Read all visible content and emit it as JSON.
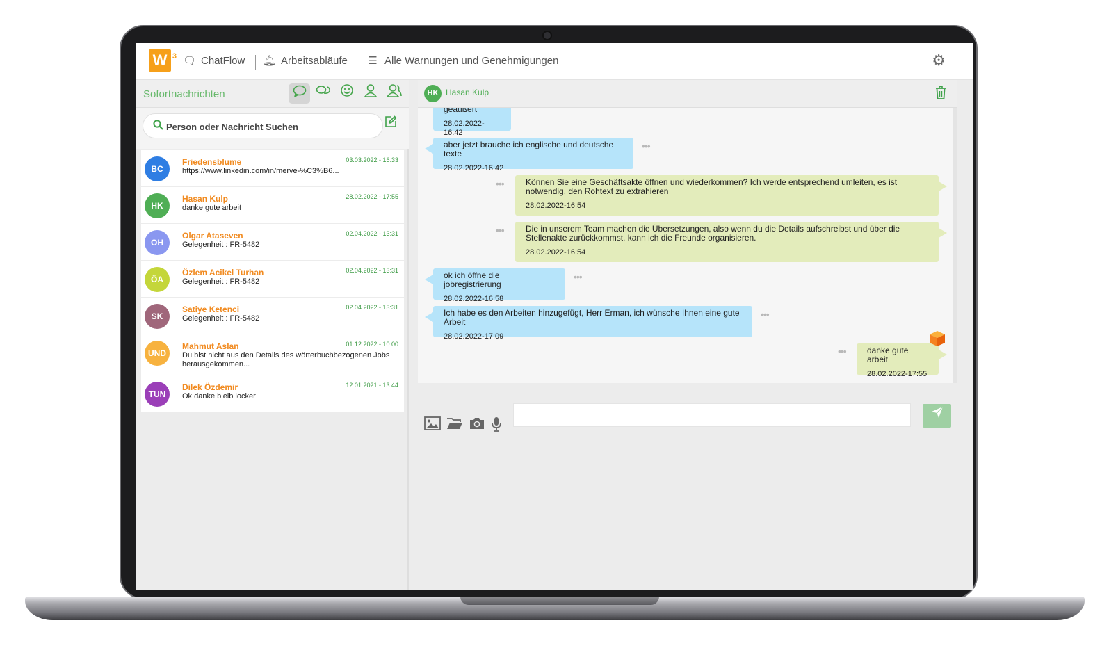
{
  "header": {
    "logo_text": "W",
    "logo_sup": "3",
    "nav": [
      {
        "label": "ChatFlow",
        "icon": "chat-bubbles-icon"
      },
      {
        "label": "Arbeitsabläufe",
        "icon": "bell-icon"
      },
      {
        "label": "Alle Warnungen und Genehmigungen",
        "icon": "list-icon"
      }
    ],
    "settings_icon": "gear-icon"
  },
  "sidebar": {
    "title": "Sofortnachrichten",
    "search_placeholder": "Person oder Nachricht Suchen",
    "contacts": [
      {
        "initials": "BC",
        "name": "Friedensblume",
        "message": "https://www.linkedin.com/in/merve-%C3%B6...",
        "time": "03.03.2022 - 16:33",
        "color": "#2f7ee3"
      },
      {
        "initials": "HK",
        "name": "Hasan Kulp",
        "message": "danke gute arbeit",
        "time": "28.02.2022 - 17:55",
        "color": "#4fae55"
      },
      {
        "initials": "OH",
        "name": "Olgar Ataseven",
        "message": "Gelegenheit : FR-5482",
        "time": "02.04.2022 - 13:31",
        "color": "#8a97f0"
      },
      {
        "initials": "ÖA",
        "name": "Özlem Acikel Turhan",
        "message": "Gelegenheit : FR-5482",
        "time": "02.04.2022 - 13:31",
        "color": "#c4d63a"
      },
      {
        "initials": "SK",
        "name": "Satiye Ketenci",
        "message": "Gelegenheit : FR-5482",
        "time": "02.04.2022 - 13:31",
        "color": "#a0677b"
      },
      {
        "initials": "UND",
        "name": "Mahmut Aslan",
        "message": "Du bist nicht aus den Details des wörterbuchbezogenen Jobs herausgekommen...",
        "time": "01.12.2022 - 10:00",
        "color": "#f7b23f"
      },
      {
        "initials": "TUN",
        "name": "Dilek Özdemir",
        "message": "Ok danke bleib locker",
        "time": "12.01.2021 - 13:44",
        "color": "#9b3fb8"
      }
    ]
  },
  "chat": {
    "contact_initials": "HK",
    "contact_name": "Hasan Kulp",
    "messages": [
      {
        "dir": "in",
        "text": "geäußert",
        "time": "28.02.2022-16:42"
      },
      {
        "dir": "in",
        "text": "aber jetzt brauche ich englische und deutsche texte",
        "time": "28.02.2022-16:42"
      },
      {
        "dir": "out",
        "text": "Können Sie eine Geschäftsakte öffnen und wiederkommen? Ich werde entsprechend umleiten, es ist notwendig, den Rohtext zu extrahieren",
        "time": "28.02.2022-16:54"
      },
      {
        "dir": "out",
        "text": "Die in unserem Team machen die Übersetzungen, also wenn du die Details aufschreibst und über die Stellenakte zurückkommst, kann ich die Freunde organisieren.",
        "time": "28.02.2022-16:54"
      },
      {
        "dir": "in",
        "text": "ok ich öffne die jobregistrierung",
        "time": "28.02.2022-16:58"
      },
      {
        "dir": "in",
        "text": "Ich habe es den Arbeiten hinzugefügt, Herr Erman, ich wünsche Ihnen eine gute Arbeit",
        "time": "28.02.2022-17:09"
      },
      {
        "dir": "out",
        "text": "danke gute arbeit",
        "time": "28.02.2022-17:55"
      }
    ],
    "options_glyph": "•••",
    "composer_icons": [
      "image-icon",
      "folder-icon",
      "camera-icon",
      "microphone-icon"
    ],
    "send_icon": "paper-plane-icon"
  },
  "colors": {
    "brand": "#f6a01a",
    "accent_green": "#4fae55",
    "name_orange": "#f18a1f",
    "incoming_bubble": "#b6e4fa",
    "outgoing_bubble": "#e3ecbb",
    "send_button": "#9fd0a3"
  }
}
